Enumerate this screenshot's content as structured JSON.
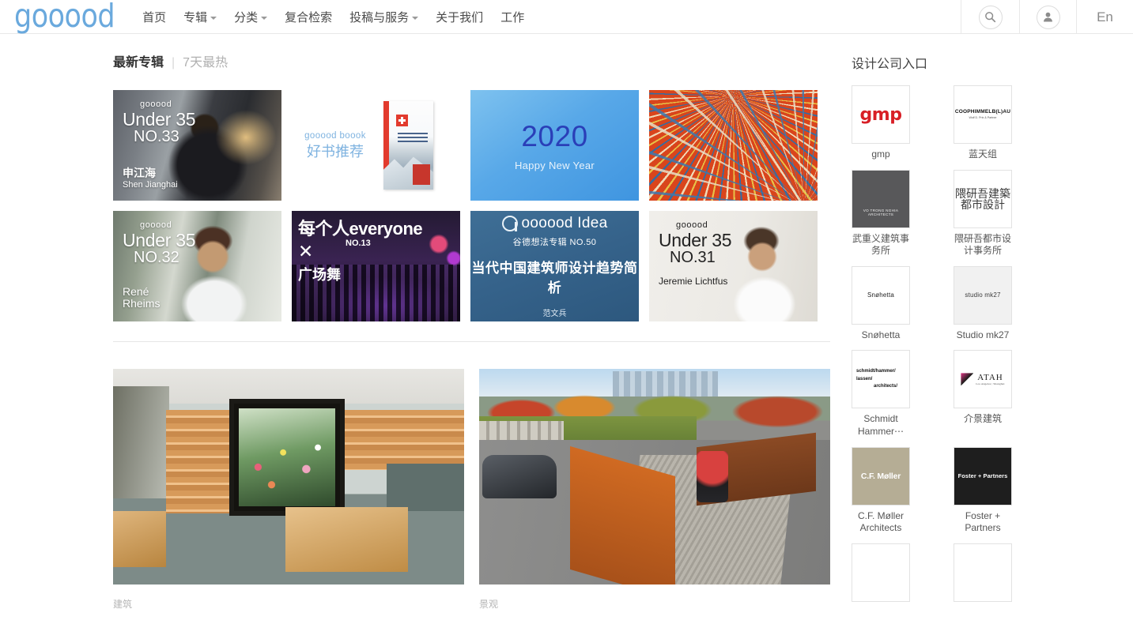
{
  "header": {
    "logo": "gooood",
    "nav": [
      {
        "label": "首页",
        "caret": false
      },
      {
        "label": "专辑",
        "caret": true
      },
      {
        "label": "分类",
        "caret": true
      },
      {
        "label": "复合检索",
        "caret": false
      },
      {
        "label": "投稿与服务",
        "caret": true
      },
      {
        "label": "关于我们",
        "caret": false
      },
      {
        "label": "工作",
        "caret": false
      }
    ],
    "search_icon": "search-icon",
    "user_icon": "user-icon",
    "language": "En"
  },
  "tabs": {
    "active": "最新专辑",
    "separator": "|",
    "inactive": "7天最热"
  },
  "cards": [
    {
      "brand": "gooood",
      "line1": "Under 35",
      "line2": "NO.33",
      "name_cn": "申江海",
      "name_en": "Shen Jianghai"
    },
    {
      "en": "gooood boook",
      "cn": "好书推荐"
    },
    {
      "year": "2020",
      "sub": "Happy New Year"
    },
    {
      "alt": "abstract-radial-strokes-artwork"
    },
    {
      "brand": "gooood",
      "line1": "Under 35",
      "line2": "NO.32",
      "name_cn": "René",
      "name_en": "Rheims"
    },
    {
      "l1_cn": "每个人",
      "l1_en": "everyone",
      "no": "NO.13",
      "x": "✕",
      "l3": "广场舞"
    },
    {
      "word": "oooood Idea",
      "sub": "谷德想法专辑 NO.50",
      "main": "当代中国建筑师设计趋势简析",
      "author": "范文兵"
    },
    {
      "brand": "gooood",
      "line1": "Under 35",
      "line2": "NO.31",
      "name_en": "Jeremie Lichtfus"
    }
  ],
  "projects": [
    {
      "category": "建筑",
      "title": ""
    },
    {
      "category": "景观",
      "title": ""
    }
  ],
  "sidebar": {
    "title": "设计公司入口",
    "firms": [
      {
        "name": "gmp",
        "logo_text": "gmp"
      },
      {
        "name": "蓝天组",
        "logo_text": "COOPHIMMELB(L)AU",
        "logo_sub": "Wolf D. Prix & Partner"
      },
      {
        "name": "武重义建筑事务所",
        "logo_text": "VO TRONG NGHIA ARCHITECTS"
      },
      {
        "name": "隈研吾都市设计事务所",
        "logo_text": "隈研吾建築都市設計"
      },
      {
        "name": "Snøhetta",
        "logo_text": "Snøhetta"
      },
      {
        "name": "Studio mk27",
        "logo_text": "studio mk27"
      },
      {
        "name": "Schmidt Hammer⋯",
        "logo_l1": "schmidt/hammer/",
        "logo_l2": "lassen/",
        "logo_l3": "architects/"
      },
      {
        "name": "介景建筑",
        "logo_text": "ATAH",
        "logo_sub": "Los Angeles | Shanghai"
      },
      {
        "name": "C.F. Møller Architects",
        "logo_text": "C.F. Møller"
      },
      {
        "name": "Foster + Partners",
        "logo_text": "Foster + Partners"
      }
    ]
  }
}
